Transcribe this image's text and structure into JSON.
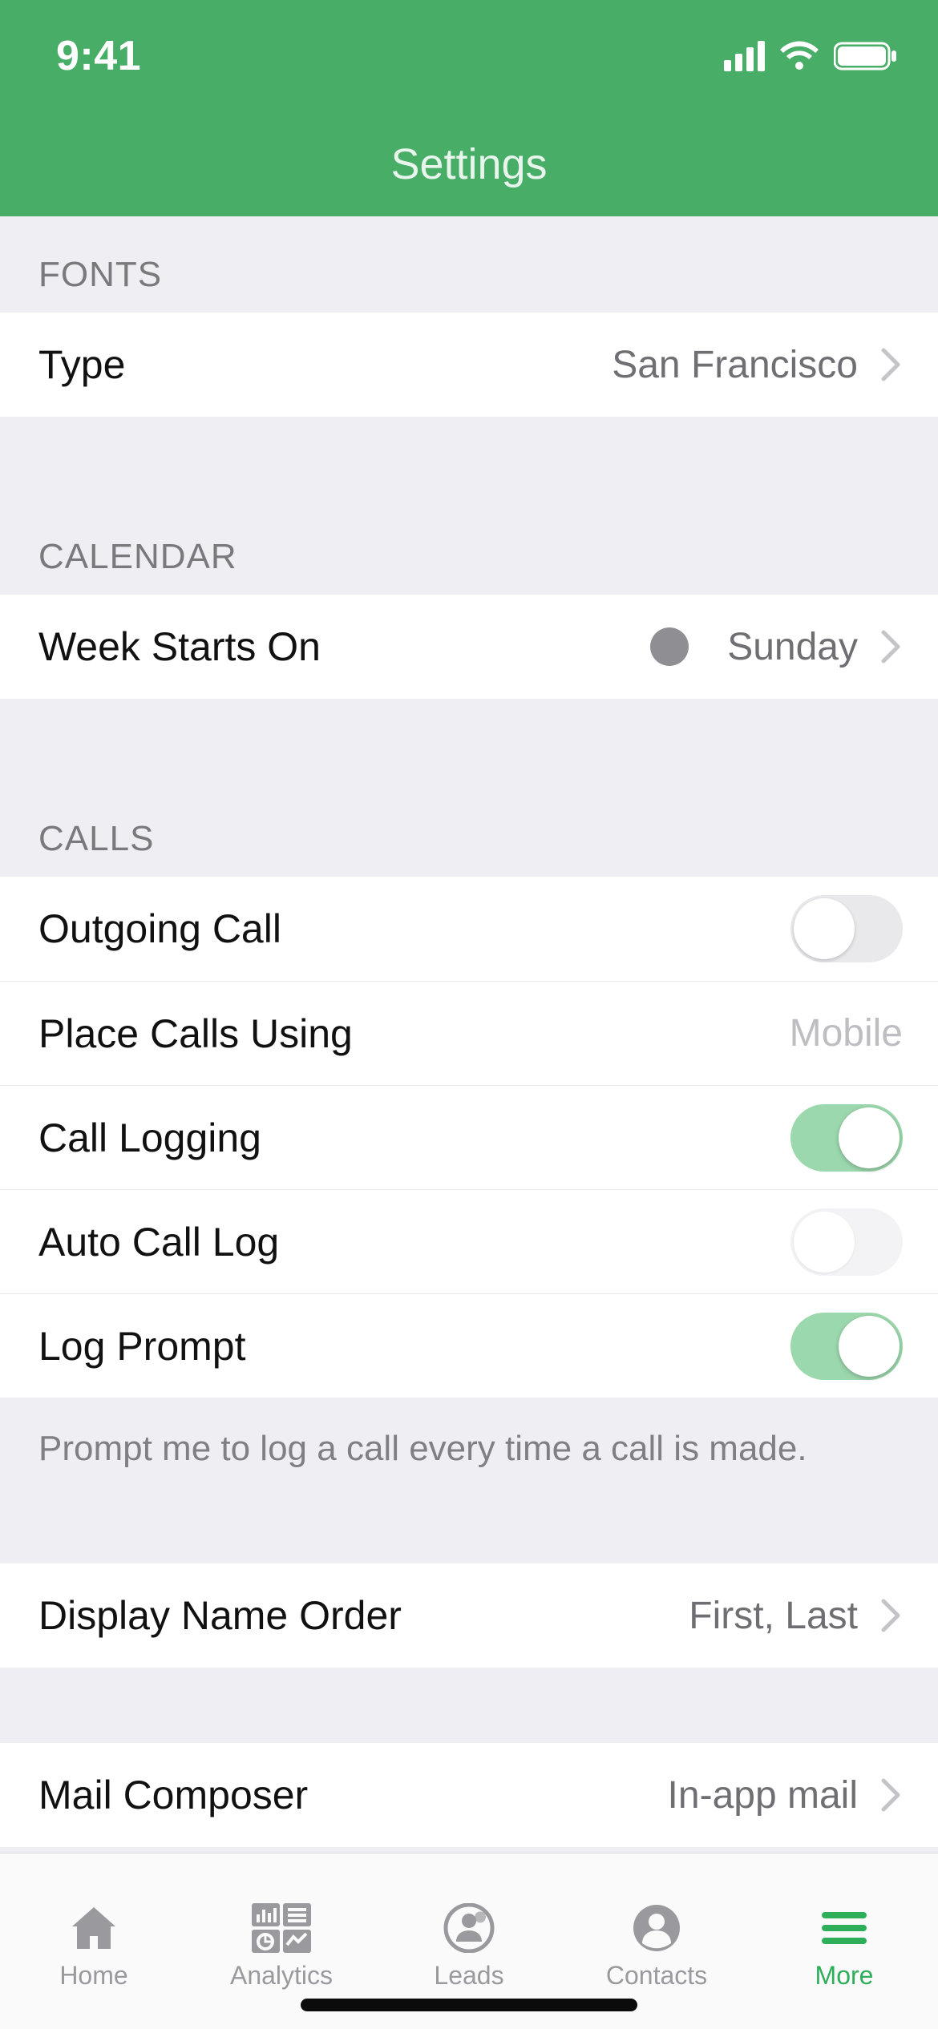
{
  "status": {
    "time": "9:41"
  },
  "nav": {
    "title": "Settings"
  },
  "sections": {
    "fonts": {
      "header": "FONTS",
      "type_label": "Type",
      "type_value": "San Francisco"
    },
    "calendar": {
      "header": "CALENDAR",
      "week_starts_label": "Week Starts On",
      "week_starts_value": "Sunday"
    },
    "calls": {
      "header": "CALLS",
      "outgoing_label": "Outgoing Call",
      "outgoing_on": false,
      "place_using_label": "Place Calls Using",
      "place_using_value": "Mobile",
      "call_logging_label": "Call Logging",
      "call_logging_on": true,
      "auto_log_label": "Auto Call Log",
      "auto_log_on": false,
      "log_prompt_label": "Log Prompt",
      "log_prompt_on": true,
      "footer": "Prompt me to log a call every time a call is made."
    },
    "display_name": {
      "label": "Display Name Order",
      "value": "First, Last"
    },
    "mail": {
      "label": "Mail Composer",
      "value": "In-app mail"
    }
  },
  "tabs": {
    "home": "Home",
    "analytics": "Analytics",
    "leads": "Leads",
    "contacts": "Contacts",
    "more": "More"
  }
}
